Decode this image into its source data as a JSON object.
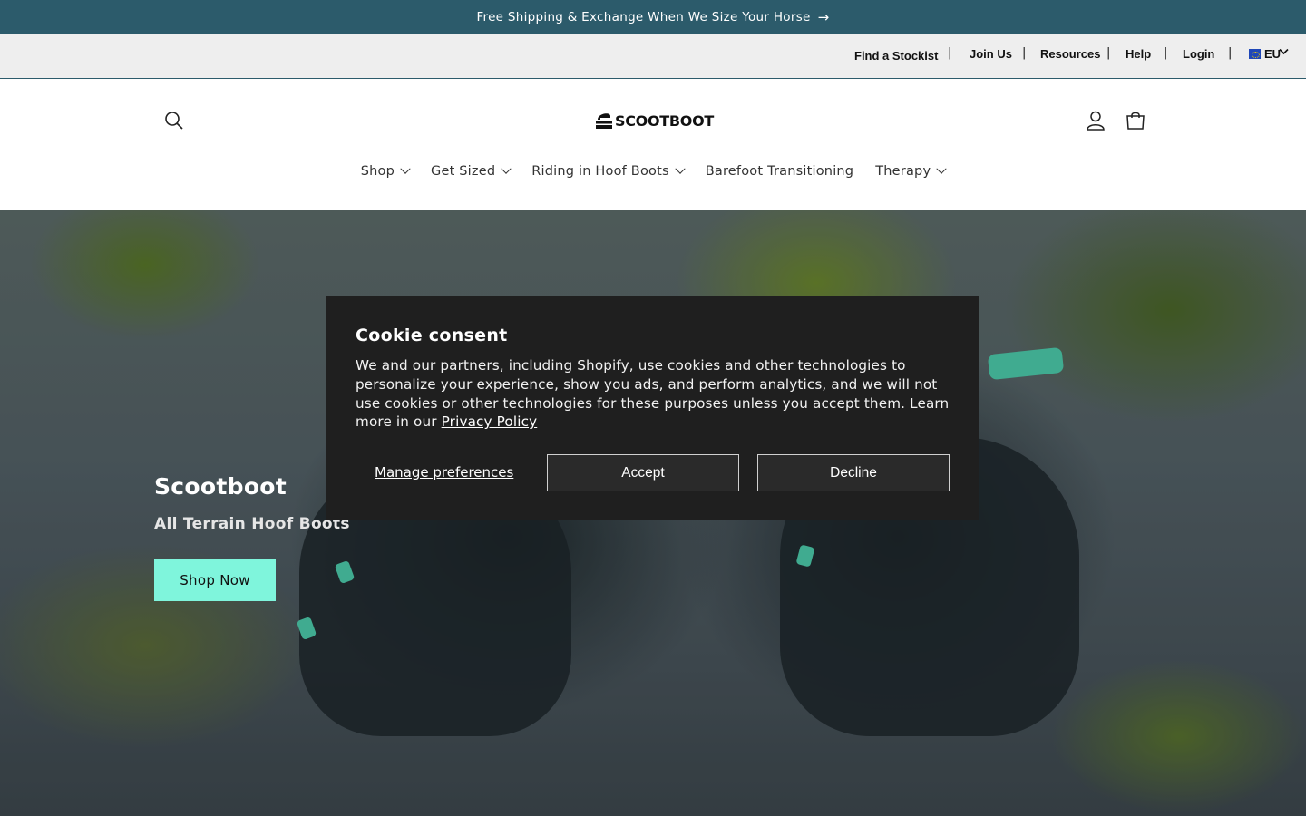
{
  "announcement": {
    "text": "Free Shipping & Exchange When We Size Your Horse",
    "arrow": "→"
  },
  "utility_nav": {
    "links": [
      "Find a Stockist",
      "Join Us",
      "Resources",
      "Help",
      "Login"
    ],
    "separator": "|",
    "region": "EU"
  },
  "header": {
    "logo_text": "SCOOTBOOT",
    "nav": [
      "Shop",
      "Get Sized",
      "Riding in Hoof Boots",
      "Barefoot Transitioning",
      "Therapy"
    ]
  },
  "hero": {
    "title": "Scootboot",
    "subtitle": "All Terrain Hoof Boots",
    "button": "Shop Now"
  },
  "cookie": {
    "title": "Cookie consent",
    "body": "We and our partners, including Shopify, use cookies and other technologies to personalize your experience, show you ads, and perform analytics, and we will not use cookies or other technologies for these purposes unless you accept them. Learn more in our ",
    "privacy_link": "Privacy Policy",
    "manage": "Manage preferences",
    "accept": "Accept",
    "decline": "Decline"
  },
  "colors": {
    "announcement_bg": "#2c5b6b",
    "hero_button": "#7ff5dc",
    "dialog_bg": "#1f1f1f",
    "strap_accent": "#4fd1b0"
  }
}
